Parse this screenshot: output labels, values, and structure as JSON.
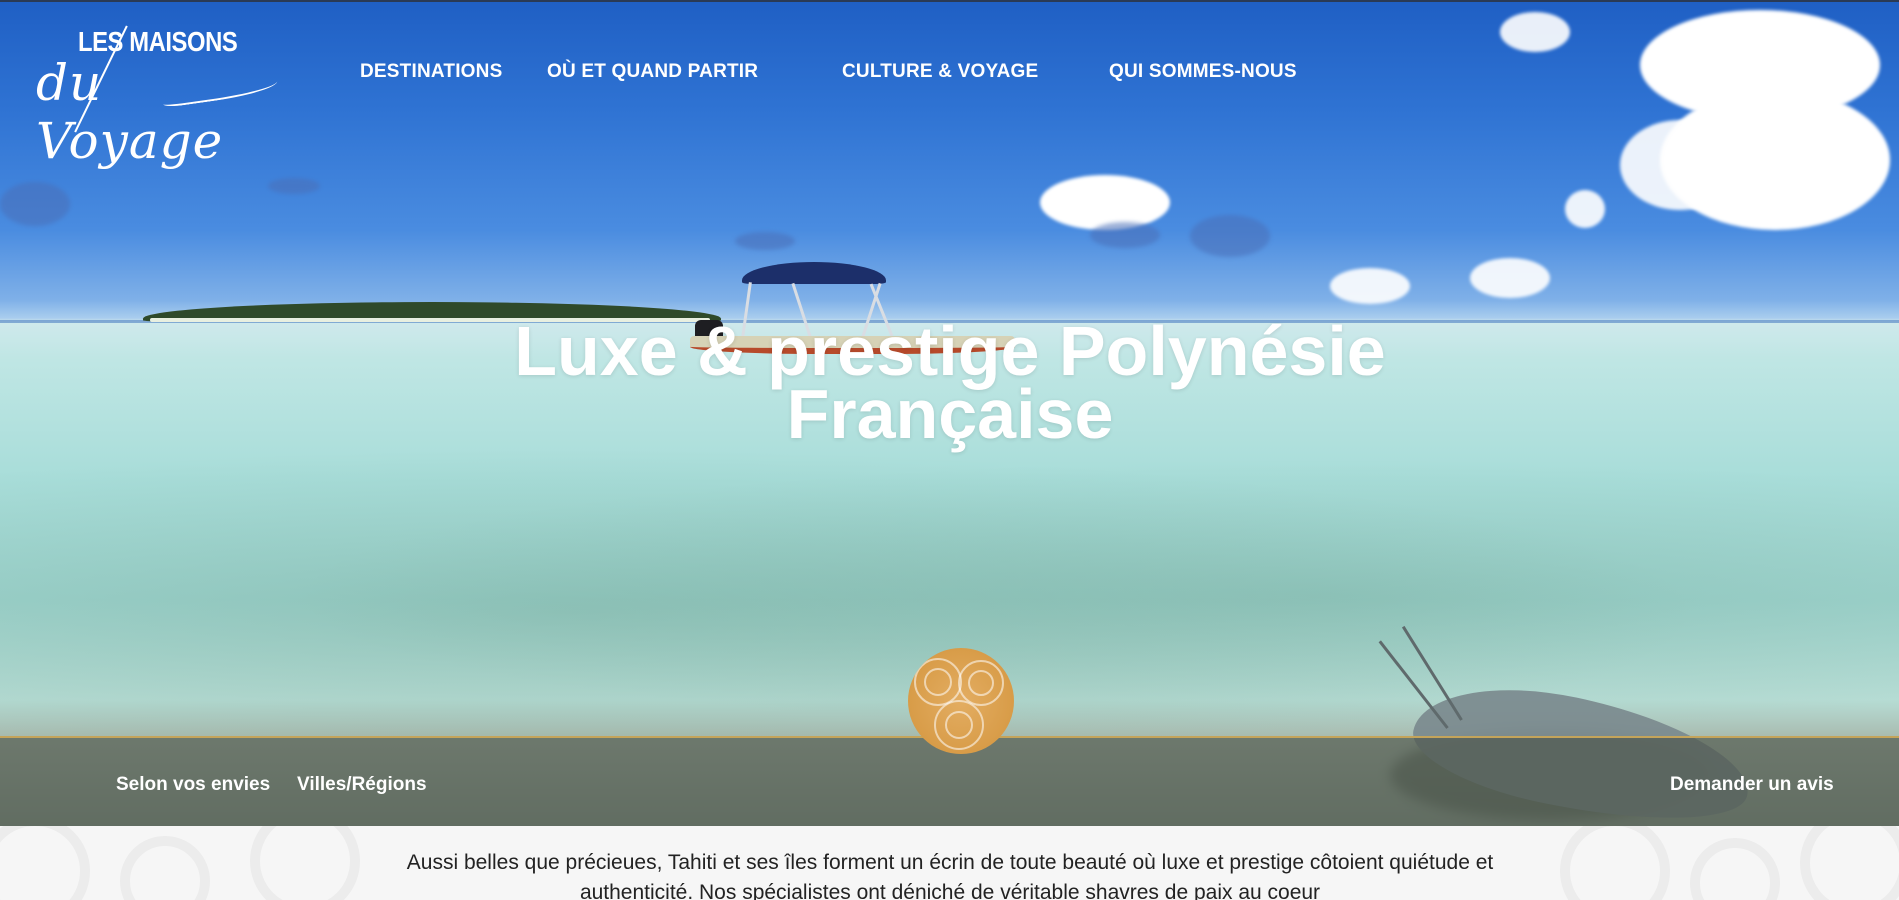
{
  "logo": {
    "line1": "LES MAISONS",
    "line2": "du Voyage"
  },
  "nav": {
    "items": [
      {
        "label": "DESTINATIONS"
      },
      {
        "label": "OÙ ET QUAND PARTIR"
      },
      {
        "label": "CULTURE & VOYAGE"
      },
      {
        "label": "QUI SOMMES-NOUS"
      }
    ]
  },
  "hero": {
    "title": "Luxe & prestige Polynésie Française"
  },
  "subnav": {
    "left": [
      {
        "label": "Selon vos envies"
      },
      {
        "label": "Villes/Régions"
      }
    ],
    "cta": "Demander un avis"
  },
  "intro": {
    "text": "Aussi belles que précieues, Tahiti et ses îles forment un écrin de toute beauté où luxe et prestige côtoient quiétude et authenticité. Nos spécialistes ont déniché de véritable shavres de paix au coeur"
  },
  "colors": {
    "accent": "#d89c48",
    "text_dark": "#222222",
    "white": "#ffffff"
  },
  "icons": {
    "emblem": "spiral-emblem-icon"
  }
}
